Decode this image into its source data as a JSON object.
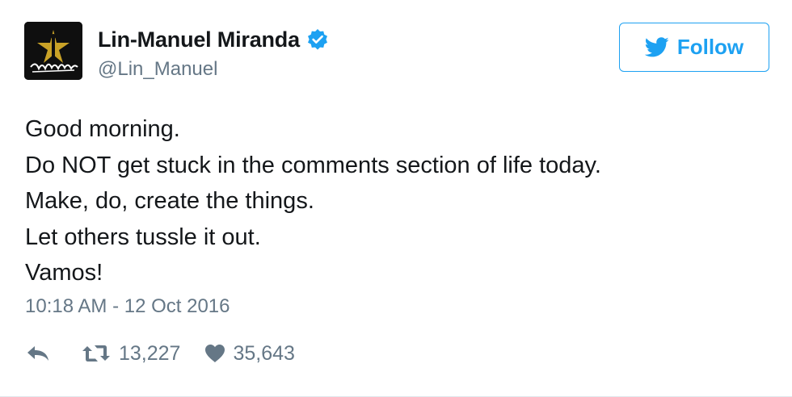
{
  "author": {
    "name": "Lin-Manuel Miranda",
    "handle": "@Lin_Manuel",
    "verified": true,
    "avatar_icon": "hamilton-logo-avatar"
  },
  "follow_button": {
    "label": "Follow",
    "icon": "twitter-bird-icon"
  },
  "tweet": {
    "lines": [
      "Good morning.",
      "Do NOT get stuck in the comments section of life today.",
      "Make, do, create the things.",
      "Let others tussle it out.",
      "Vamos!"
    ],
    "timestamp": "10:18 AM - 12 Oct 2016"
  },
  "actions": {
    "reply_icon": "reply-icon",
    "retweet_icon": "retweet-icon",
    "retweet_count": "13,227",
    "like_icon": "heart-icon",
    "like_count": "35,643"
  },
  "colors": {
    "brand_blue": "#1da1f2",
    "text_primary": "#14171a",
    "text_secondary": "#657786"
  }
}
